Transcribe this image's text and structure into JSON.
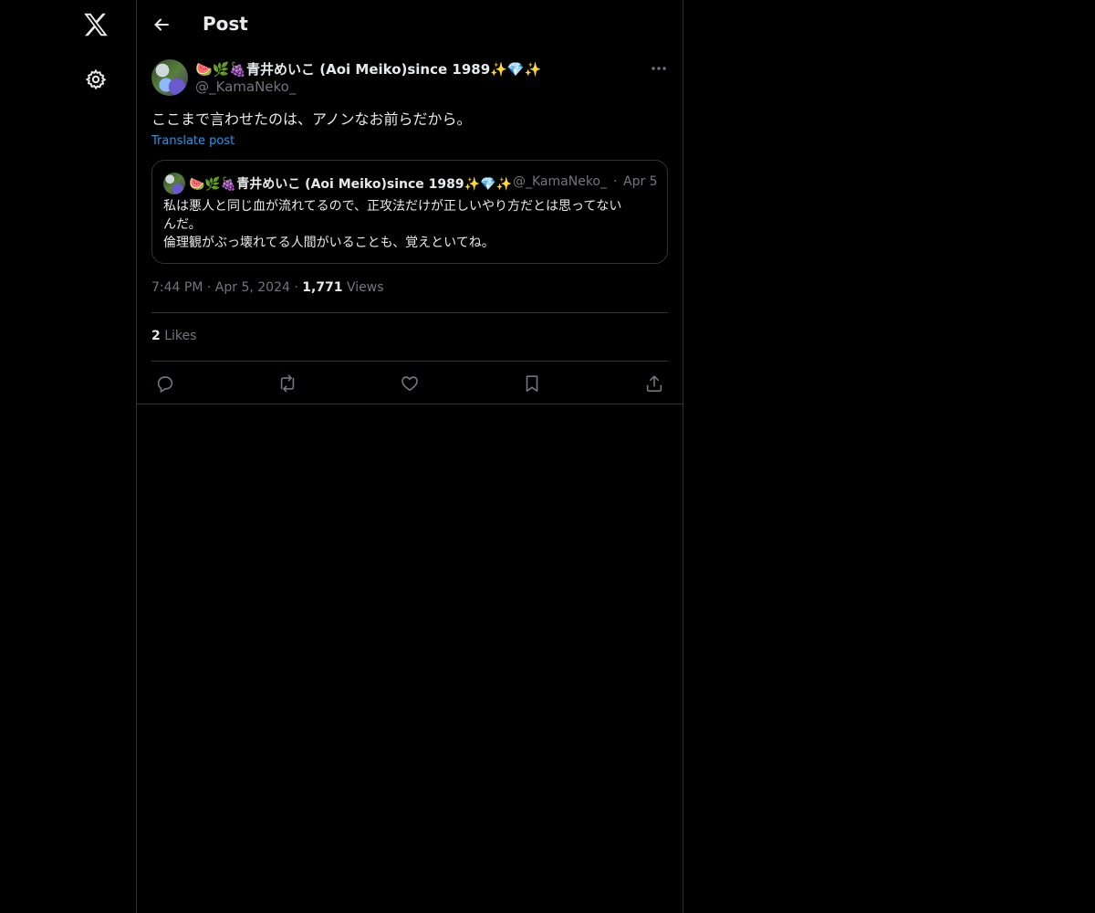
{
  "sidebar": {
    "logo_icon": "x-logo-icon",
    "settings_icon": "gear-icon"
  },
  "header": {
    "back_icon": "arrow-left-icon",
    "title": "Post"
  },
  "post": {
    "author_name": "🍉🌿🍇青井めいこ (Aoi Meiko)since 1989✨💎✨",
    "author_handle": "@_KamaNeko_",
    "more_icon": "more-horizontal-icon",
    "text": "ここまで言わせたのは、アノンなお前らだから。",
    "translate_label": "Translate post",
    "quote": {
      "author_name": "🍉🌿🍇青井めいこ (Aoi Meiko)since 1989✨💎✨",
      "author_handle": "@_KamaNeko_",
      "separator": "·",
      "date": "Apr 5",
      "lines": [
        "私は悪人と同じ血が流れてるので、正攻法だけが正しいやり方だとは思ってない",
        "んだ。",
        "倫理観がぶっ壊れてる人間がいることも、覚えといてね。"
      ]
    },
    "time": "7:44 PM",
    "separator": "·",
    "date": "Apr 5, 2024",
    "views_count": "1,771",
    "views_label": "Views",
    "likes_count": "2",
    "likes_label": "Likes",
    "actions": [
      "reply-icon",
      "repost-icon",
      "like-icon",
      "bookmark-icon",
      "share-icon"
    ]
  },
  "colors": {
    "background": "#000000",
    "text": "#e7e9ea",
    "muted": "#71767b",
    "accent": "#1d9bf0",
    "border": "#2f3336"
  }
}
